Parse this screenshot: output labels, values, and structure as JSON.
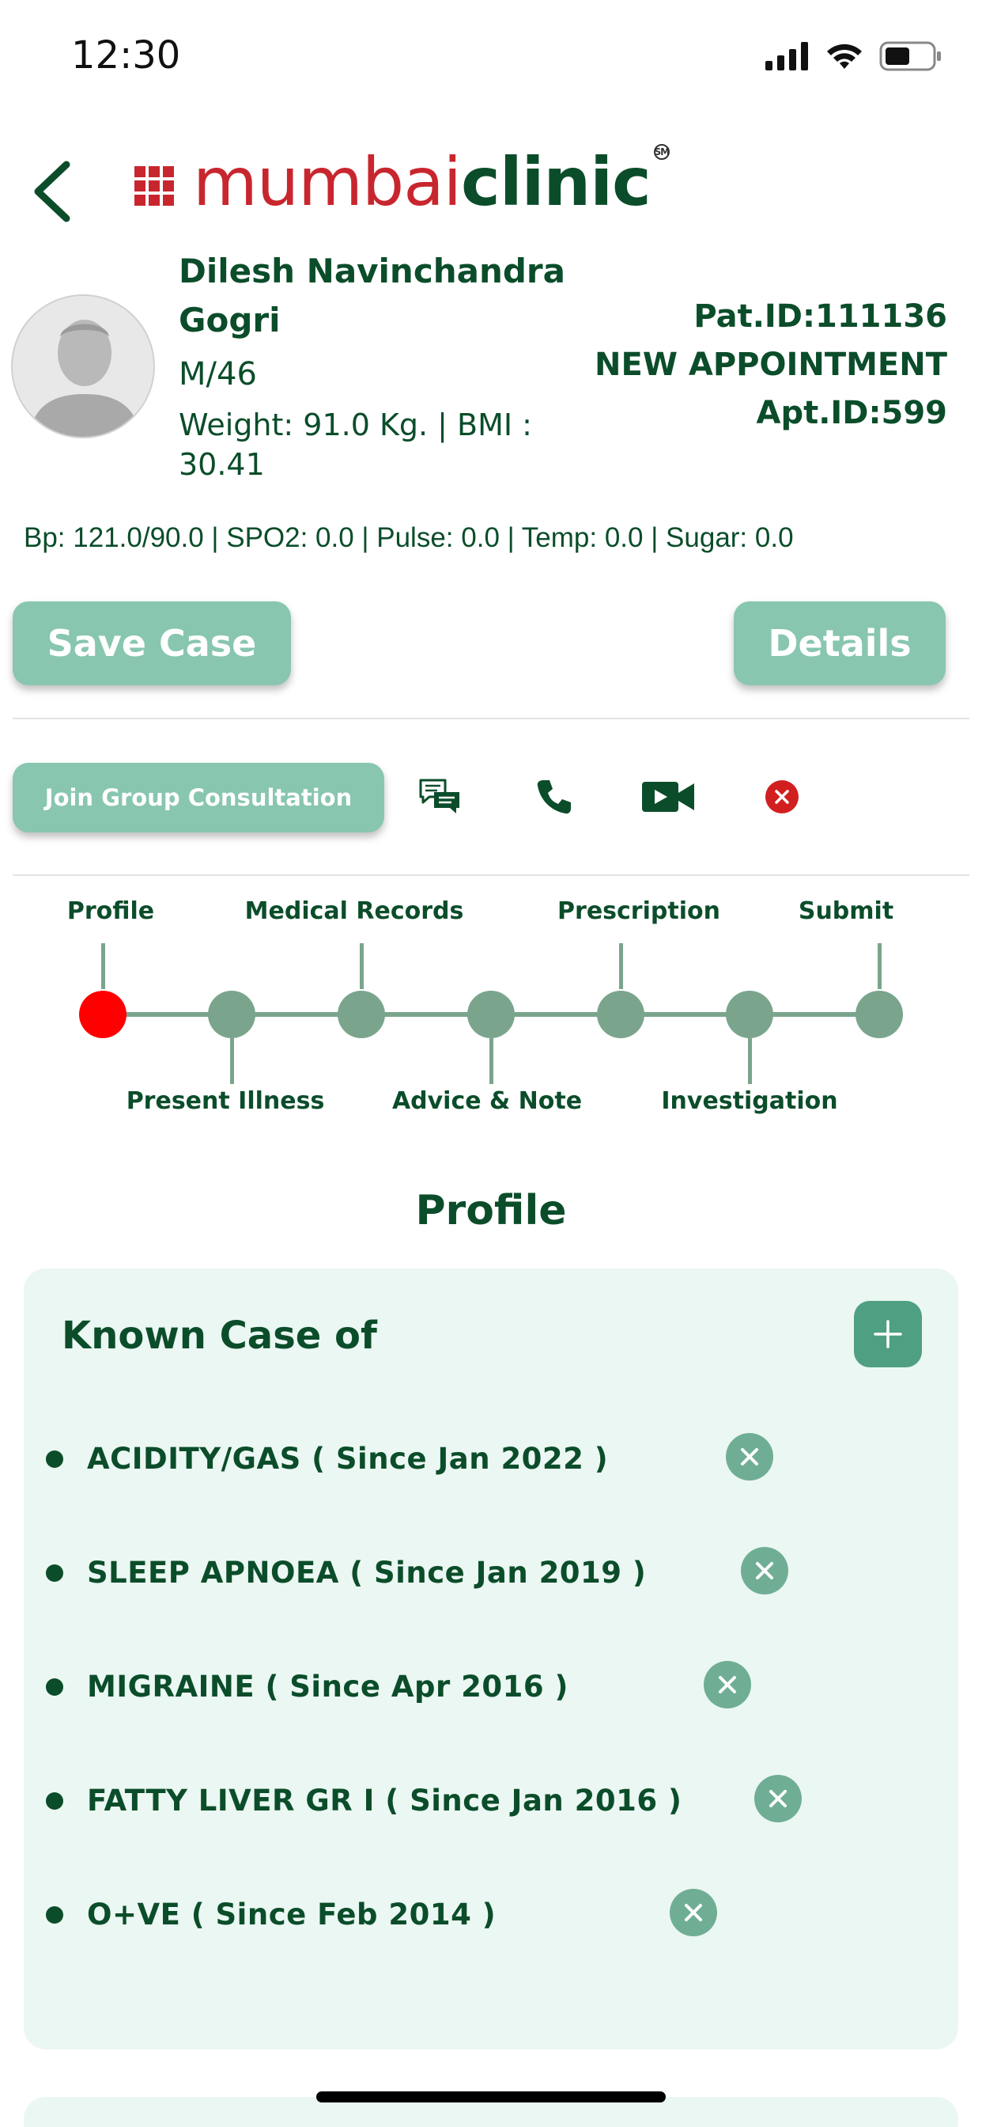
{
  "status_bar": {
    "time": "12:30"
  },
  "header": {
    "brand_part1": "mumbai",
    "brand_part2": "clinic",
    "brand_mark": "SM"
  },
  "patient": {
    "name": "Dilesh Navinchandra Gogri",
    "sex_age": "M/46",
    "weight_bmi": "Weight: 91.0 Kg. | BMI : 30.41",
    "patient_id": "Pat.ID:111136",
    "appointment_type": "NEW APPOINTMENT",
    "appointment_id": "Apt.ID:599",
    "vitals": "Bp: 121.0/90.0 | SPO2: 0.0 | Pulse: 0.0 | Temp: 0.0 | Sugar: 0.0"
  },
  "actions": {
    "save_label": "Save Case",
    "details_label": "Details",
    "join_label": "Join Group Consultation"
  },
  "icons": {
    "chat": "chat-icon",
    "phone": "phone-icon",
    "video": "video-icon",
    "end": "close-icon"
  },
  "stepper": {
    "steps": [
      {
        "label": "Profile",
        "active": true
      },
      {
        "label": "Present Illness",
        "active": false
      },
      {
        "label": "Medical Records",
        "active": false
      },
      {
        "label": "Advice & Note",
        "active": false
      },
      {
        "label": "Prescription",
        "active": false
      },
      {
        "label": "Investigation",
        "active": false
      },
      {
        "label": "Submit",
        "active": false
      }
    ]
  },
  "section_title": "Profile",
  "known_case": {
    "title": "Known Case of",
    "items": [
      "ACIDITY/GAS ( Since Jan 2022 )",
      "SLEEP APNOEA ( Since Jan 2019 )",
      "MIGRAINE ( Since Apr 2016 )",
      "FATTY LIVER GR I ( Since Jan 2016 )",
      "O+VE ( Since Feb 2014 )"
    ]
  },
  "colors": {
    "primary_dark": "#0b4d2a",
    "button_green": "#88c6af",
    "brand_red": "#c8262e",
    "active_step": "#ff0000",
    "card_bg": "#ebf7f2"
  }
}
